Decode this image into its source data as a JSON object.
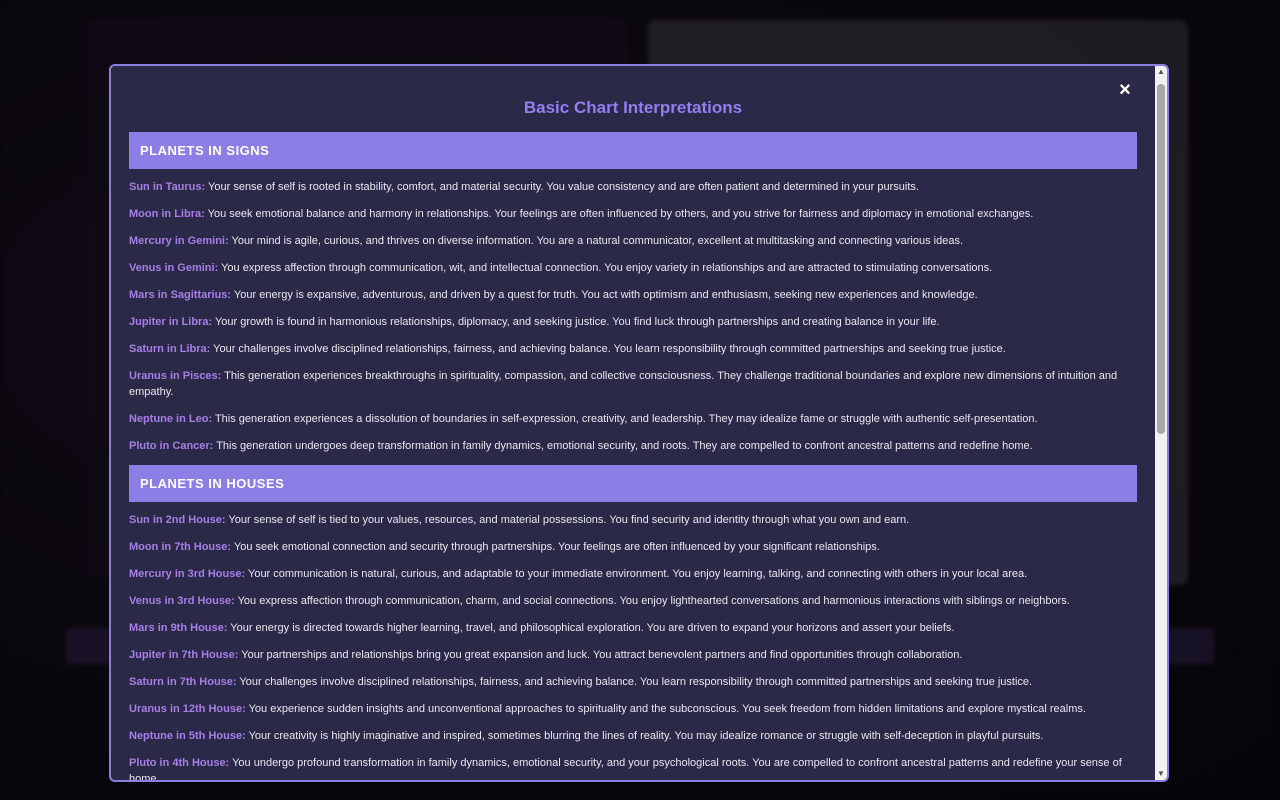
{
  "modal": {
    "title": "Basic Chart Interpretations",
    "close_label": "×"
  },
  "sections": [
    {
      "header": "PLANETS IN SIGNS",
      "entries": [
        {
          "label": "Sun in Taurus:",
          "text": " Your sense of self is rooted in stability, comfort, and material security. You value consistency and are often patient and determined in your pursuits."
        },
        {
          "label": "Moon in Libra:",
          "text": " You seek emotional balance and harmony in relationships. Your feelings are often influenced by others, and you strive for fairness and diplomacy in emotional exchanges."
        },
        {
          "label": "Mercury in Gemini:",
          "text": " Your mind is agile, curious, and thrives on diverse information. You are a natural communicator, excellent at multitasking and connecting various ideas."
        },
        {
          "label": "Venus in Gemini:",
          "text": " You express affection through communication, wit, and intellectual connection. You enjoy variety in relationships and are attracted to stimulating conversations."
        },
        {
          "label": "Mars in Sagittarius:",
          "text": " Your energy is expansive, adventurous, and driven by a quest for truth. You act with optimism and enthusiasm, seeking new experiences and knowledge."
        },
        {
          "label": "Jupiter in Libra:",
          "text": " Your growth is found in harmonious relationships, diplomacy, and seeking justice. You find luck through partnerships and creating balance in your life."
        },
        {
          "label": "Saturn in Libra:",
          "text": " Your challenges involve disciplined relationships, fairness, and achieving balance. You learn responsibility through committed partnerships and seeking true justice."
        },
        {
          "label": "Uranus in Pisces:",
          "text": " This generation experiences breakthroughs in spirituality, compassion, and collective consciousness. They challenge traditional boundaries and explore new dimensions of intuition and empathy."
        },
        {
          "label": "Neptune in Leo:",
          "text": " This generation experiences a dissolution of boundaries in self-expression, creativity, and leadership. They may idealize fame or struggle with authentic self-presentation."
        },
        {
          "label": "Pluto in Cancer:",
          "text": " This generation undergoes deep transformation in family dynamics, emotional security, and roots. They are compelled to confront ancestral patterns and redefine home."
        }
      ]
    },
    {
      "header": "PLANETS IN HOUSES",
      "entries": [
        {
          "label": "Sun in 2nd House:",
          "text": " Your sense of self is tied to your values, resources, and material possessions. You find security and identity through what you own and earn."
        },
        {
          "label": "Moon in 7th House:",
          "text": " You seek emotional connection and security through partnerships. Your feelings are often influenced by your significant relationships."
        },
        {
          "label": "Mercury in 3rd House:",
          "text": " Your communication is natural, curious, and adaptable to your immediate environment. You enjoy learning, talking, and connecting with others in your local area."
        },
        {
          "label": "Venus in 3rd House:",
          "text": " You express affection through communication, charm, and social connections. You enjoy lighthearted conversations and harmonious interactions with siblings or neighbors."
        },
        {
          "label": "Mars in 9th House:",
          "text": " Your energy is directed towards higher learning, travel, and philosophical exploration. You are driven to expand your horizons and assert your beliefs."
        },
        {
          "label": "Jupiter in 7th House:",
          "text": " Your partnerships and relationships bring you great expansion and luck. You attract benevolent partners and find opportunities through collaboration."
        },
        {
          "label": "Saturn in 7th House:",
          "text": " Your challenges involve disciplined relationships, fairness, and achieving balance. You learn responsibility through committed partnerships and seeking true justice."
        },
        {
          "label": "Uranus in 12th House:",
          "text": " You experience sudden insights and unconventional approaches to spirituality and the subconscious. You seek freedom from hidden limitations and explore mystical realms."
        },
        {
          "label": "Neptune in 5th House:",
          "text": " Your creativity is highly imaginative and inspired, sometimes blurring the lines of reality. You may idealize romance or struggle with self-deception in playful pursuits."
        },
        {
          "label": "Pluto in 4th House:",
          "text": " You undergo profound transformation in family dynamics, emotional security, and your psychological roots. You are compelled to confront ancestral patterns and redefine your sense of home."
        }
      ]
    }
  ],
  "scrollbar": {
    "up_icon": "scroll-up-arrow-icon",
    "down_icon": "scroll-down-arrow-icon"
  }
}
